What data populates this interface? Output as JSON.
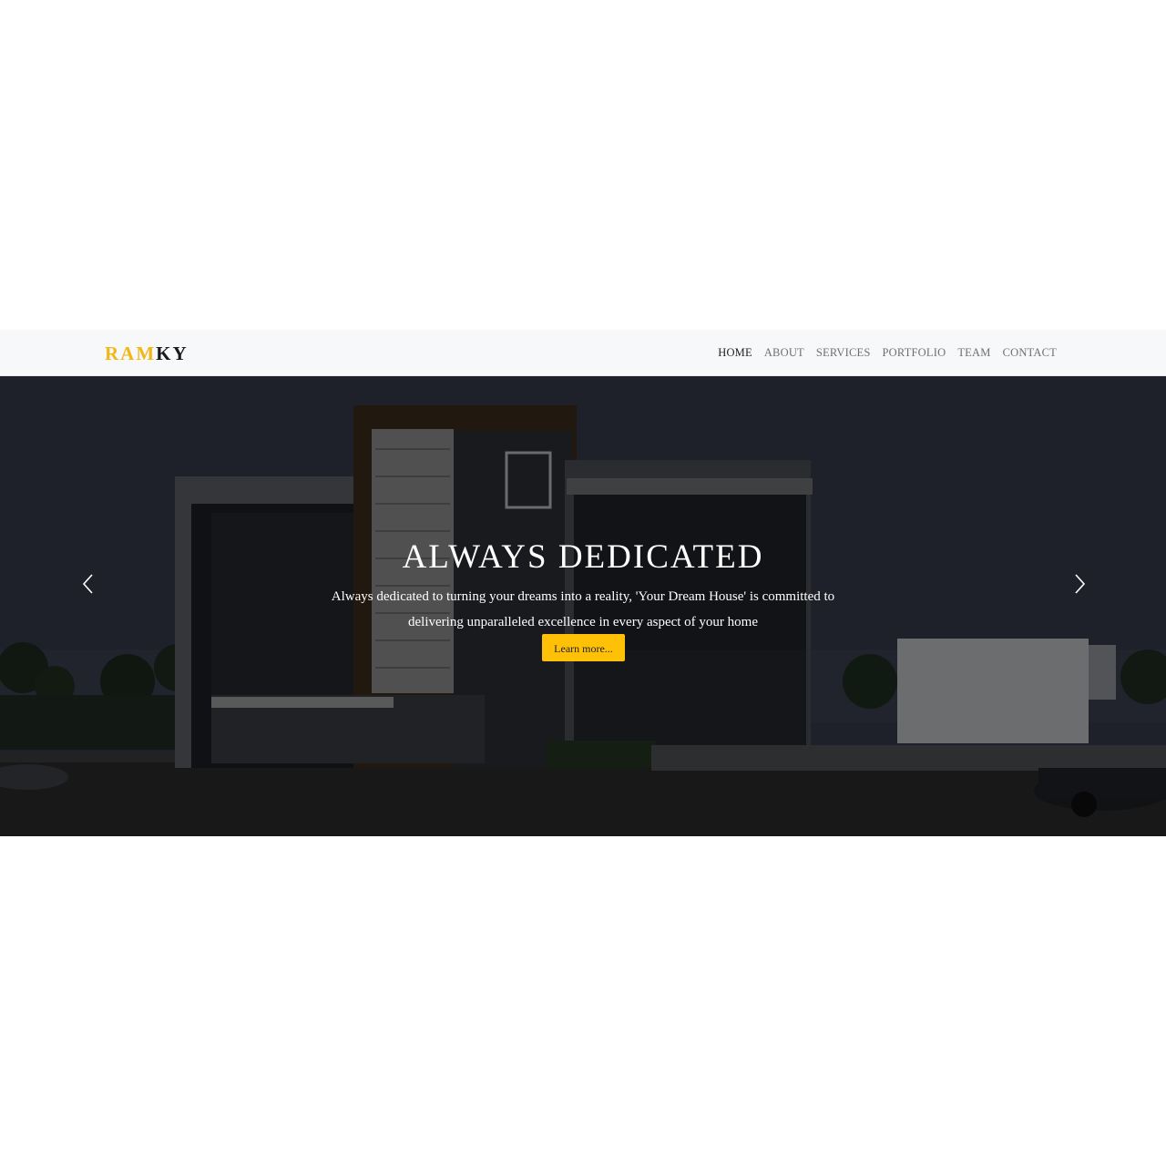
{
  "brand": {
    "part1": "RAM",
    "part2": "KY",
    "colors": {
      "accent": "#f2b615",
      "dark": "#1a1a1a"
    }
  },
  "nav": {
    "items": [
      {
        "label": "HOME",
        "active": true
      },
      {
        "label": "ABOUT",
        "active": false
      },
      {
        "label": "SERVICES",
        "active": false
      },
      {
        "label": "PORTFOLIO",
        "active": false
      },
      {
        "label": "TEAM",
        "active": false
      },
      {
        "label": "CONTACT",
        "active": false
      }
    ]
  },
  "hero": {
    "title": "ALWAYS DEDICATED",
    "text": "Always dedicated to turning your dreams into a reality, 'Your Dream House' is committed to delivering unparalleled excellence in every aspect of your home",
    "button_label": "Learn more...",
    "button_color": "#ffc107",
    "prev_icon": "chevron-left-icon",
    "next_icon": "chevron-right-icon"
  }
}
